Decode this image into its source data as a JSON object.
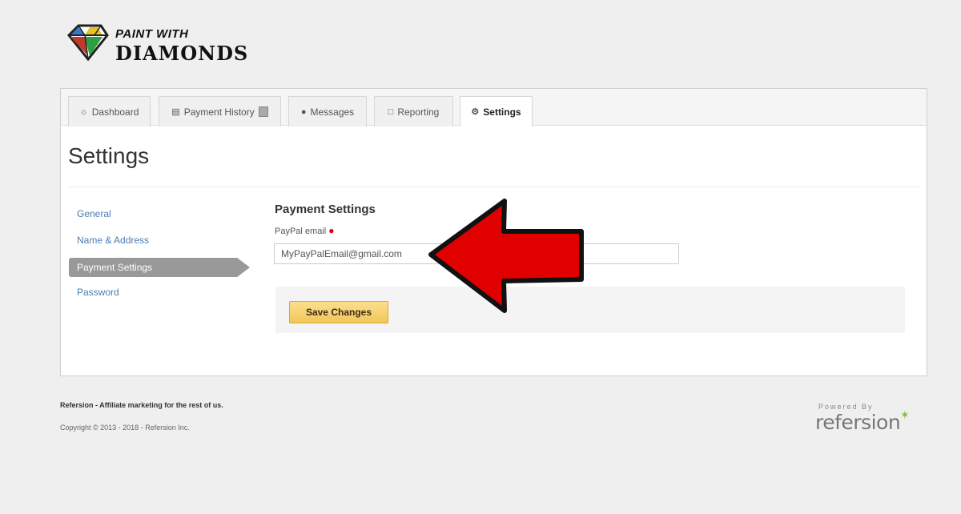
{
  "brand": {
    "line1": "PAINT WITH",
    "line2": "DIAMONDS",
    "logo_icon": "diamond-icon"
  },
  "tabs": [
    {
      "label": "Dashboard",
      "icon": "dashboard-icon",
      "active": false
    },
    {
      "label": "Payment History",
      "icon": "money-icon",
      "active": false
    },
    {
      "label": "Messages",
      "icon": "chat-bubble-icon",
      "active": false
    },
    {
      "label": "Reporting",
      "icon": "bar-chart-icon",
      "active": false
    },
    {
      "label": "Settings",
      "icon": "gear-icon",
      "active": true
    }
  ],
  "page": {
    "title": "Settings"
  },
  "sidebar": {
    "items": [
      {
        "label": "General",
        "active": false
      },
      {
        "label": "Name & Address",
        "active": false
      },
      {
        "label": "Payment Settings",
        "active": true
      },
      {
        "label": "Password",
        "active": false
      }
    ]
  },
  "payment": {
    "section_title": "Payment Settings",
    "paypal_label": "PayPal email",
    "required_marker": "●",
    "paypal_value": "MyPayPalEmail@gmail.com",
    "save_label": "Save Changes"
  },
  "annotation": {
    "arrow_color": "#e00000"
  },
  "footer": {
    "tagline": "Refersion - Affiliate marketing for the rest of us.",
    "copyright": "Copyright © 2013 - 2018 - Refersion Inc.",
    "powered_label": "Powered By",
    "powered_brand": "refersion",
    "powered_star": "✶"
  },
  "colors": {
    "link": "#4a7cb2",
    "accent_button": "#f1c65a",
    "sidebar_active": "#999999"
  }
}
